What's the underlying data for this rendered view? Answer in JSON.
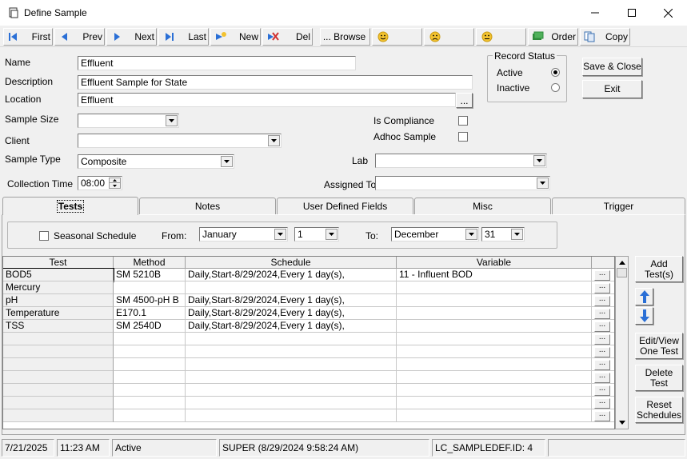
{
  "window": {
    "title": "Define Sample"
  },
  "toolbar": {
    "first": "First",
    "prev": "Prev",
    "next": "Next",
    "last": "Last",
    "new": "New",
    "del": "Del",
    "browse": "... Browse",
    "order": "Order",
    "copy": "Copy"
  },
  "form": {
    "name_label": "Name",
    "name_value": "Effluent",
    "description_label": "Description",
    "description_value": "Effluent Sample for State",
    "location_label": "Location",
    "location_value": "Effluent",
    "location_btn": "...",
    "sample_size_label": "Sample Size",
    "sample_size_value": "",
    "client_label": "Client",
    "client_value": "",
    "sample_type_label": "Sample Type",
    "sample_type_value": "Composite",
    "collection_time_label": "Collection Time",
    "collection_time_value": "08:00",
    "is_compliance_label": "Is Compliance",
    "adhoc_label": "Adhoc Sample",
    "lab_label": "Lab",
    "lab_value": "",
    "assigned_label": "Assigned To",
    "assigned_value": ""
  },
  "record_status": {
    "title": "Record Status",
    "active": "Active",
    "inactive": "Inactive"
  },
  "buttons": {
    "save_close": "Save & Close",
    "exit": "Exit"
  },
  "tabs": [
    {
      "label": "Tests"
    },
    {
      "label": "Notes"
    },
    {
      "label": "User Defined Fields"
    },
    {
      "label": "Misc"
    },
    {
      "label": "Trigger"
    }
  ],
  "seasonal": {
    "label": "Seasonal Schedule",
    "from_label": "From:",
    "from_month": "January",
    "from_day": "1",
    "to_label": "To:",
    "to_month": "December",
    "to_day": "31"
  },
  "grid": {
    "headers": [
      "Test",
      "Method",
      "Schedule",
      "Variable"
    ],
    "rows": [
      [
        "BOD5",
        "SM 5210B",
        "Daily,Start-8/29/2024,Every 1 day(s),",
        "11 - Influent BOD"
      ],
      [
        "Mercury",
        "",
        "",
        ""
      ],
      [
        "pH",
        "SM 4500-pH B",
        "Daily,Start-8/29/2024,Every 1 day(s),",
        ""
      ],
      [
        "Temperature",
        "E170.1",
        "Daily,Start-8/29/2024,Every 1 day(s),",
        ""
      ],
      [
        "TSS",
        "SM 2540D",
        "Daily,Start-8/29/2024,Every 1 day(s),",
        ""
      ]
    ],
    "ellipsis": "..."
  },
  "side_buttons": {
    "add_tests": "Add Test(s)",
    "edit_view": "Edit/View One Test",
    "delete_test": "Delete Test",
    "reset_schedules": "Reset Schedules"
  },
  "statusbar": {
    "date": "7/21/2025",
    "time": "11:23 AM",
    "state": "Active",
    "user": "SUPER (8/29/2024 9:58:24 AM)",
    "id": "LC_SAMPLEDEF.ID: 4"
  },
  "colors": {
    "nav_blue": "#2a6fd6",
    "smiley": "#f2c230",
    "order_green": "#2e8b3a",
    "del_red": "#d03030"
  }
}
